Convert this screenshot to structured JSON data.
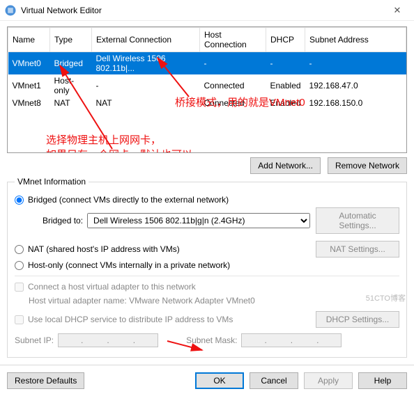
{
  "window": {
    "title": "Virtual Network Editor",
    "close": "✕"
  },
  "table": {
    "headers": [
      "Name",
      "Type",
      "External Connection",
      "Host Connection",
      "DHCP",
      "Subnet Address"
    ],
    "rows": [
      {
        "name": "VMnet0",
        "type": "Bridged",
        "ext": "Dell Wireless 1506 802.11b|...",
        "host": "-",
        "dhcp": "-",
        "subnet": "-",
        "selected": true
      },
      {
        "name": "VMnet1",
        "type": "Host-only",
        "ext": "-",
        "host": "Connected",
        "dhcp": "Enabled",
        "subnet": "192.168.47.0",
        "selected": false
      },
      {
        "name": "VMnet8",
        "type": "NAT",
        "ext": "NAT",
        "host": "Connected",
        "dhcp": "Enabled",
        "subnet": "192.168.150.0",
        "selected": false
      }
    ]
  },
  "annotations": {
    "line1": "桥接模式，用的就是VMnet0",
    "line2": "选择物理主机上网网卡，\n如果只有一个网卡，默认也可以"
  },
  "netbtns": {
    "add": "Add Network...",
    "remove": "Remove Network"
  },
  "group": {
    "legend": "VMnet Information"
  },
  "radios": {
    "bridged": "Bridged (connect VMs directly to the external network)",
    "nat": "NAT (shared host's IP address with VMs)",
    "hostonly": "Host-only (connect VMs internally in a private network)"
  },
  "bridge": {
    "label": "Bridged to:",
    "selected": "Dell Wireless 1506 802.11b|g|n (2.4GHz)",
    "auto_btn": "Automatic Settings..."
  },
  "natBtn": "NAT Settings...",
  "checks": {
    "hostAdapter": "Connect a host virtual adapter to this network",
    "hostAdapterHint": "Host virtual adapter name: VMware Network Adapter VMnet0",
    "dhcp": "Use local DHCP service to distribute IP address to VMs",
    "dhcpBtn": "DHCP Settings..."
  },
  "ipfields": {
    "subnetIp": "Subnet IP:",
    "subnetMask": "Subnet Mask:"
  },
  "bottom": {
    "restore": "Restore Defaults",
    "ok": "OK",
    "cancel": "Cancel",
    "apply": "Apply",
    "help": "Help"
  },
  "watermark": "51CTO博客"
}
